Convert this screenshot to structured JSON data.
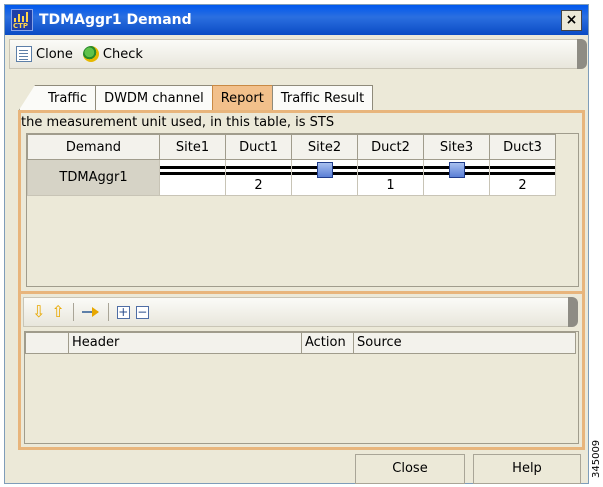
{
  "window": {
    "title": "TDMAggr1 Demand",
    "app_icon": "ctp-icon",
    "app_icon_text": "CTP",
    "close_glyph": "×"
  },
  "toolbar": {
    "clone_label": "Clone",
    "check_label": "Check"
  },
  "tabs": [
    {
      "label": "Traffic",
      "active": false
    },
    {
      "label": "DWDM channel",
      "active": false
    },
    {
      "label": "Report",
      "active": true
    },
    {
      "label": "Traffic Result",
      "active": false
    }
  ],
  "report": {
    "unit_text": "the measurement unit used, in this table, is  STS",
    "columns": [
      "Demand",
      "Site1",
      "Duct1",
      "Site2",
      "Duct2",
      "Site3",
      "Duct3"
    ],
    "rows": [
      {
        "demand": "TDMAggr1",
        "duct1": "2",
        "duct2": "1",
        "duct3": "2"
      }
    ]
  },
  "bottom": {
    "toolbar_icons": [
      "arrow-down-icon",
      "arrow-up-icon",
      "move-icon",
      "expand-icon",
      "collapse-icon"
    ],
    "columns": [
      "",
      "Header",
      "Action",
      "Source"
    ]
  },
  "footer": {
    "close_label": "Close",
    "help_label": "Help"
  },
  "side_code": "345009",
  "colors": {
    "title_bar": "#0058ee",
    "active_tab": "#f2c08b",
    "panel_border": "#e8b57c",
    "site_node": "#5a7fd6"
  }
}
